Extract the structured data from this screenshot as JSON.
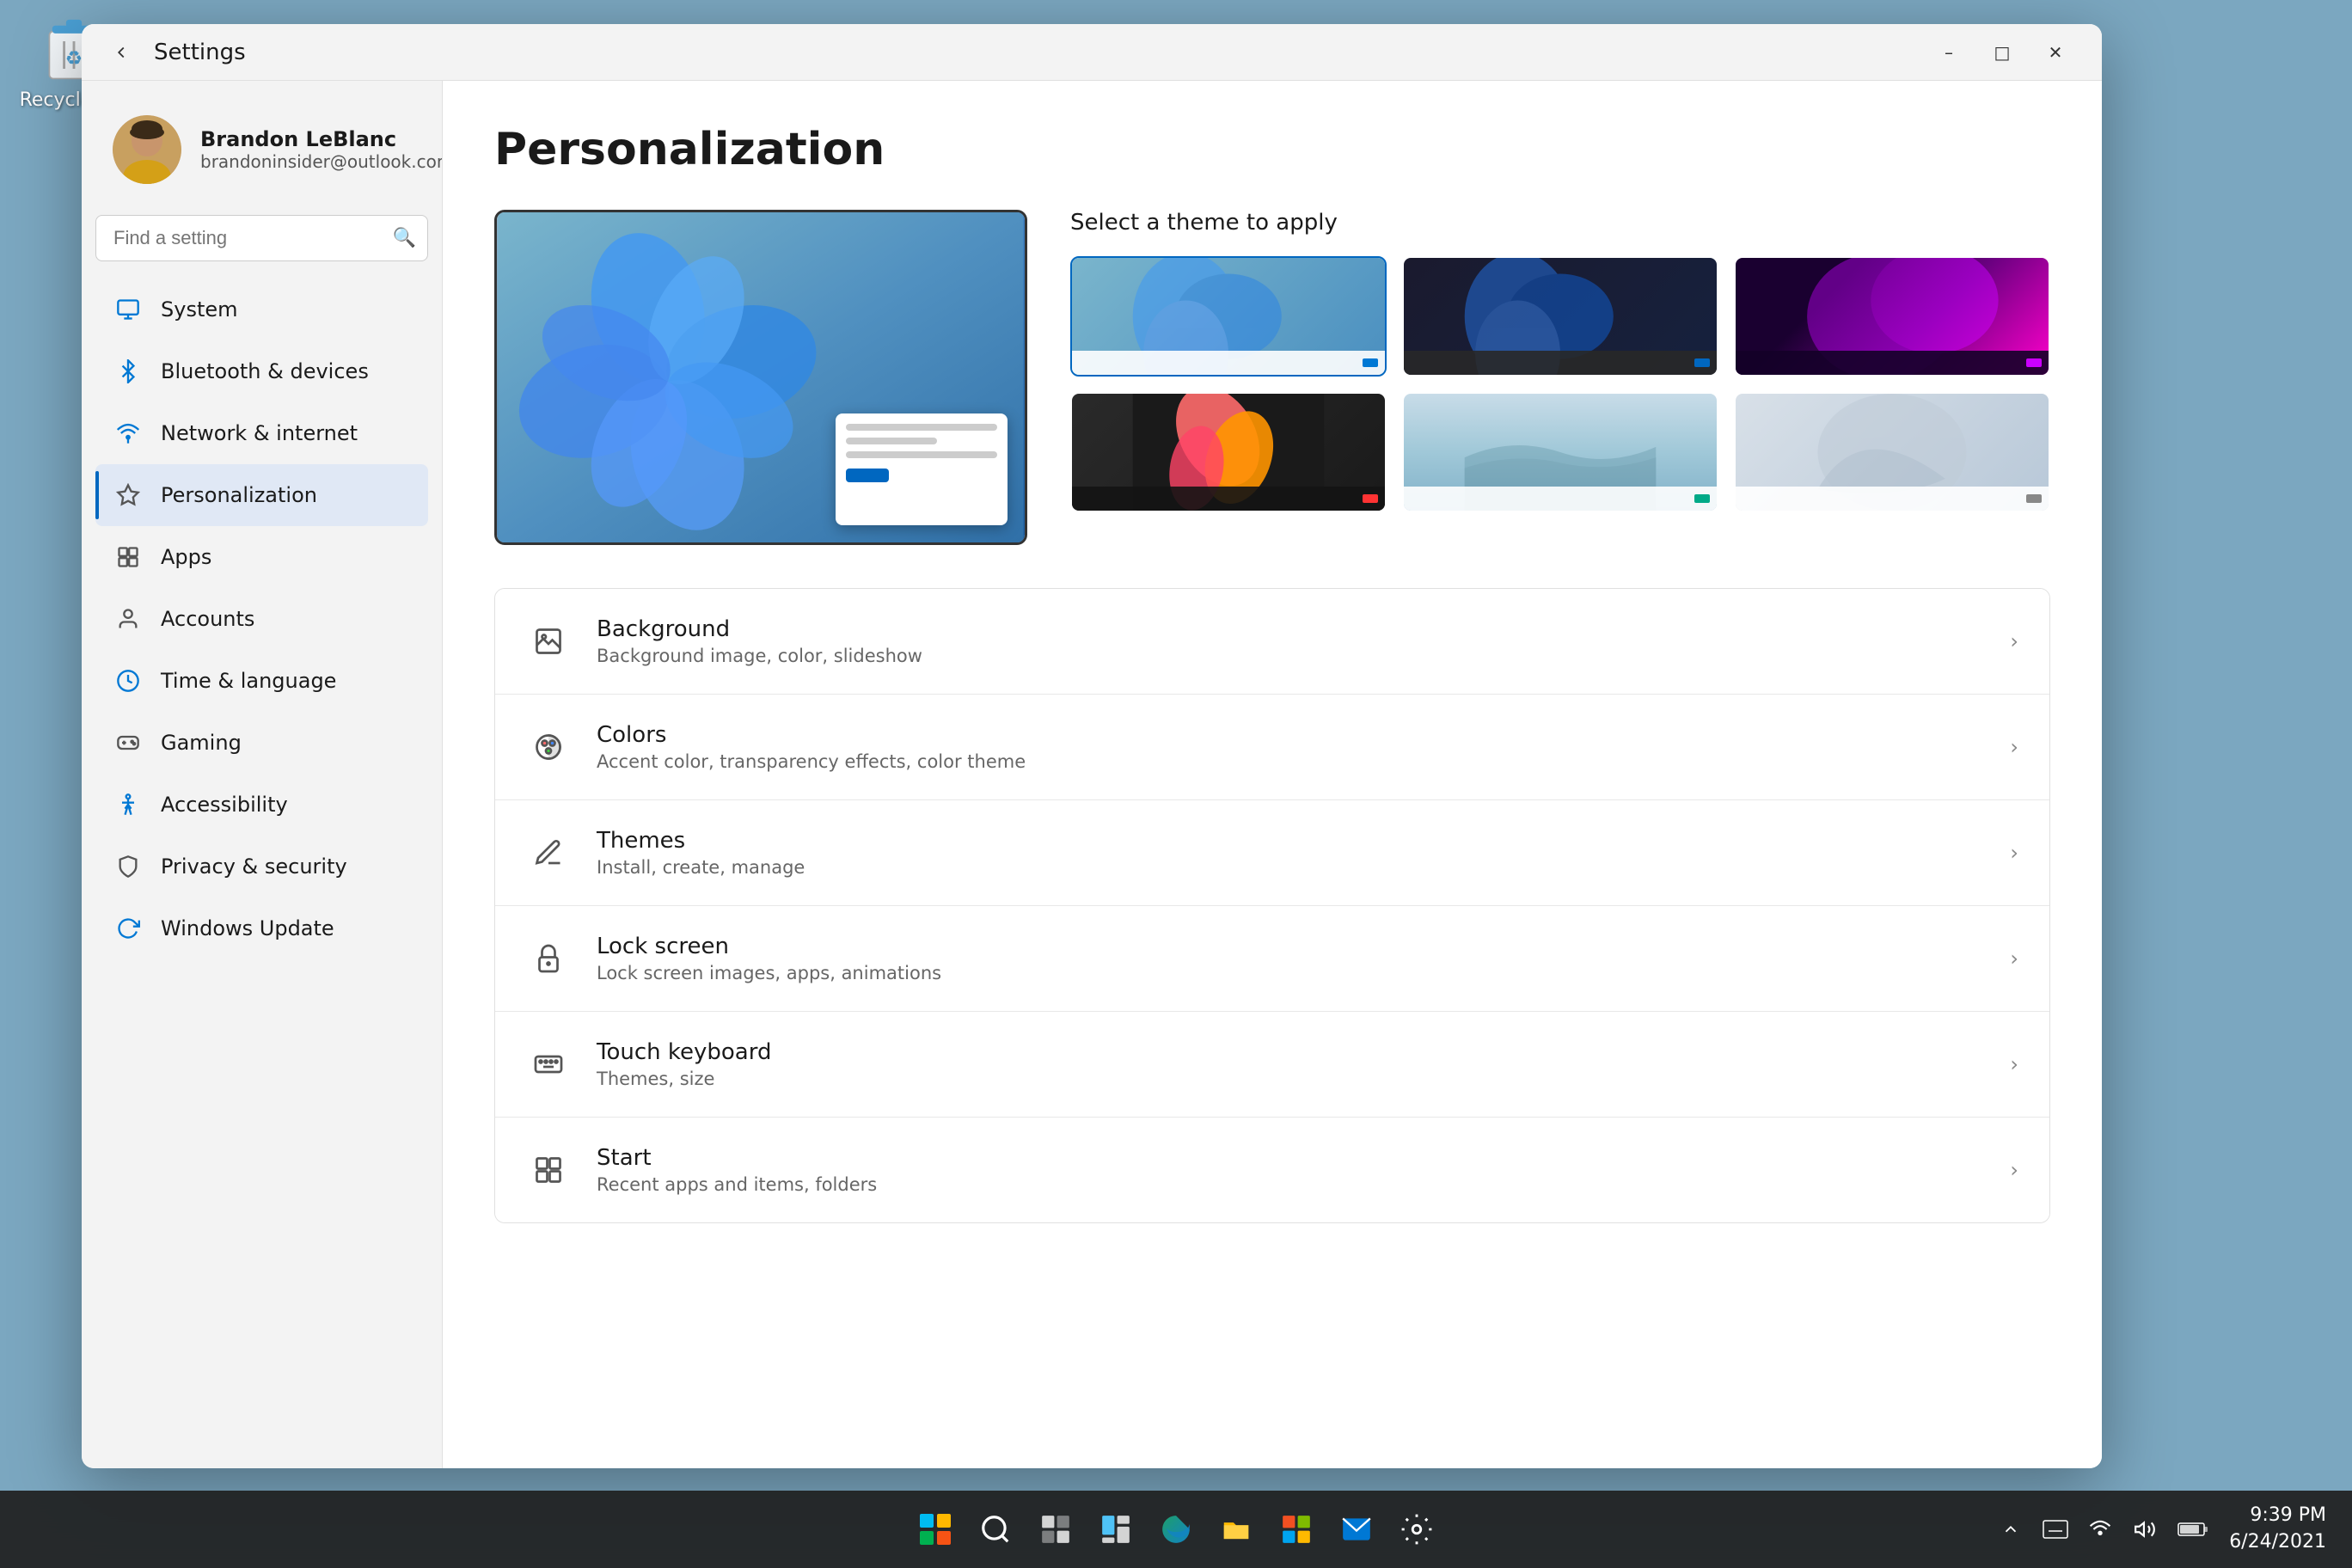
{
  "desktop": {
    "recycle_bin_label": "Recycle Bin"
  },
  "taskbar": {
    "clock_time": "9:39 PM",
    "clock_date": "6/24/2021",
    "icons": [
      "start",
      "search",
      "file-explorer",
      "snap-assist",
      "edge",
      "file-explorer-2",
      "microsoft-store",
      "mail",
      "settings"
    ]
  },
  "window": {
    "title": "Settings",
    "back_tooltip": "Back",
    "minimize_label": "–",
    "maximize_label": "□",
    "close_label": "✕"
  },
  "user": {
    "name": "Brandon LeBlanc",
    "email": "brandoninsider@outlook.com"
  },
  "search": {
    "placeholder": "Find a setting"
  },
  "nav": {
    "items": [
      {
        "id": "system",
        "label": "System",
        "color": "#0078d4"
      },
      {
        "id": "bluetooth",
        "label": "Bluetooth & devices",
        "color": "#0078d4"
      },
      {
        "id": "network",
        "label": "Network & internet",
        "color": "#0078d4"
      },
      {
        "id": "personalization",
        "label": "Personalization",
        "color": "#555",
        "active": true
      },
      {
        "id": "apps",
        "label": "Apps",
        "color": "#555"
      },
      {
        "id": "accounts",
        "label": "Accounts",
        "color": "#555"
      },
      {
        "id": "time",
        "label": "Time & language",
        "color": "#0078d4"
      },
      {
        "id": "gaming",
        "label": "Gaming",
        "color": "#555"
      },
      {
        "id": "accessibility",
        "label": "Accessibility",
        "color": "#0078d4"
      },
      {
        "id": "privacy",
        "label": "Privacy & security",
        "color": "#555"
      },
      {
        "id": "update",
        "label": "Windows Update",
        "color": "#0078d4"
      }
    ]
  },
  "main": {
    "title": "Personalization",
    "theme_selector_title": "Select a theme to apply",
    "themes": [
      {
        "id": "win11-light",
        "bg1": "#89b4cc",
        "bg2": "#5a9fd4",
        "bar_color": "#0078d4",
        "selected": true
      },
      {
        "id": "win11-dark",
        "bg1": "#1a1a2e",
        "bg2": "#16213e",
        "bar_color": "#0078d4",
        "selected": false
      },
      {
        "id": "win11-purple",
        "bg1": "#1a0030",
        "bg2": "#6a0080",
        "bar_color": "#cc00ff",
        "selected": false
      },
      {
        "id": "floral",
        "bg1": "#ff6b6b",
        "bg2": "#ffa500",
        "bar_color": "#ff3333",
        "selected": false
      },
      {
        "id": "calm-water",
        "bg1": "#b8d4e0",
        "bg2": "#8fb8d0",
        "bar_color": "#00aa88",
        "selected": false
      },
      {
        "id": "abstract",
        "bg1": "#d0d8e0",
        "bg2": "#a8b8c8",
        "bar_color": "#888",
        "selected": false
      }
    ],
    "settings_items": [
      {
        "id": "background",
        "title": "Background",
        "description": "Background image, color, slideshow",
        "icon": "image"
      },
      {
        "id": "colors",
        "title": "Colors",
        "description": "Accent color, transparency effects, color theme",
        "icon": "palette"
      },
      {
        "id": "themes",
        "title": "Themes",
        "description": "Install, create, manage",
        "icon": "brush"
      },
      {
        "id": "lock-screen",
        "title": "Lock screen",
        "description": "Lock screen images, apps, animations",
        "icon": "lock"
      },
      {
        "id": "touch-keyboard",
        "title": "Touch keyboard",
        "description": "Themes, size",
        "icon": "keyboard"
      },
      {
        "id": "start",
        "title": "Start",
        "description": "Recent apps and items, folders",
        "icon": "start"
      }
    ]
  }
}
